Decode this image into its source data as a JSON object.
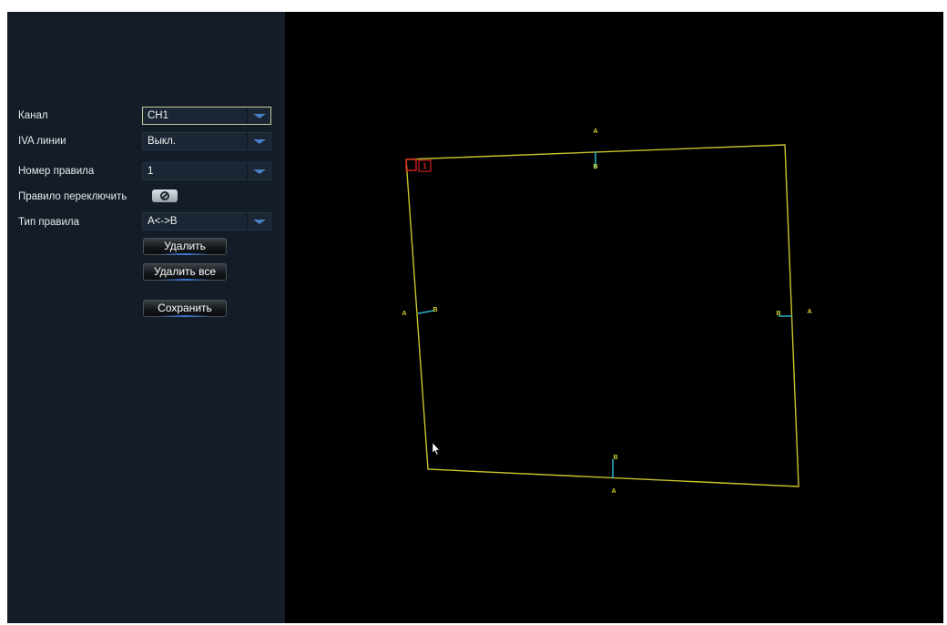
{
  "rows": {
    "channel": {
      "label": "Канал",
      "value": "CH1"
    },
    "iva_line": {
      "label": "IVA линии",
      "value": "Выкл."
    },
    "rule_number": {
      "label": "Номер правила",
      "value": "1"
    },
    "rule_switch": {
      "label": "Правило переключить"
    },
    "rule_type": {
      "label": "Тип правила",
      "value": "A<->B"
    }
  },
  "buttons": {
    "delete": "Удалить",
    "delete_all": "Удалить все",
    "save": "Сохранить"
  },
  "canvas": {
    "rule_index": "1",
    "side_a": "A",
    "side_b": "B",
    "line_color": "#c8c42c",
    "direction_color": "#2fb6c8",
    "selected_color": "#d21c1c"
  },
  "colors": {
    "sidebar_bg": "#141d27",
    "screen_bg": "#000000",
    "dropdown_arrow": "#4a7fc6"
  }
}
